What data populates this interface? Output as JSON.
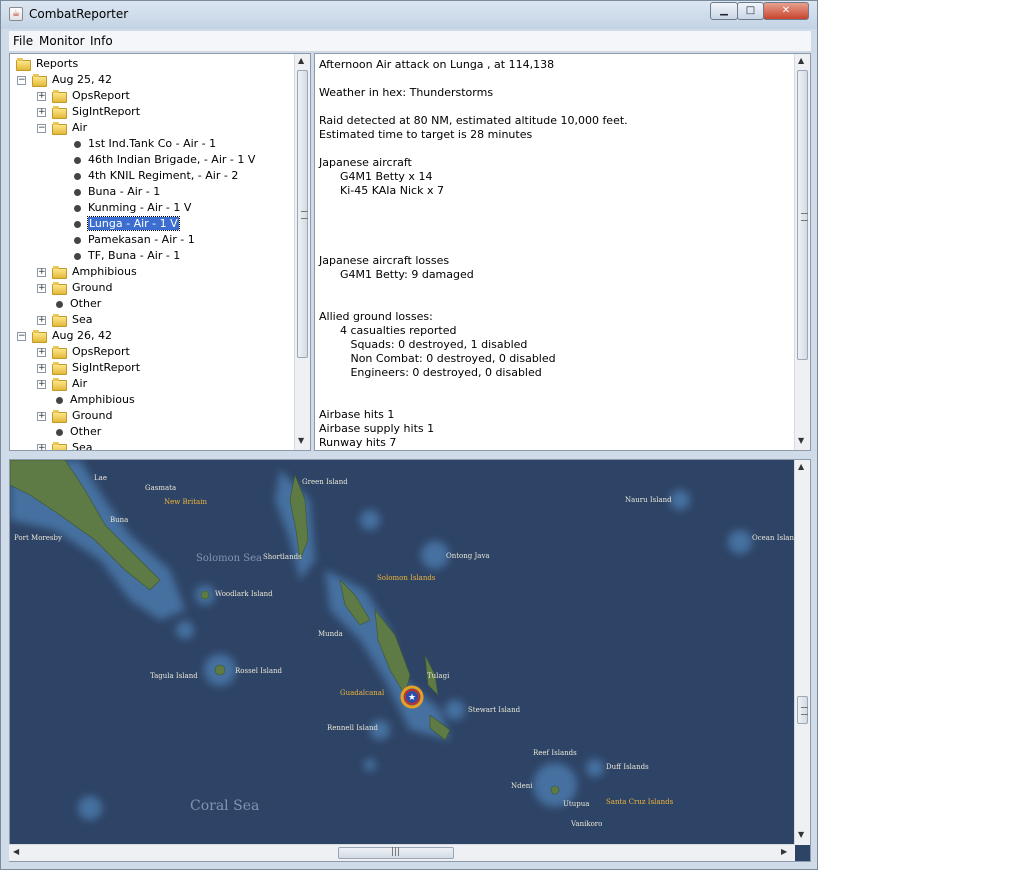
{
  "window": {
    "title": "CombatReporter",
    "app_icon": "java-icon",
    "controls": {
      "minimize": "minimize-icon",
      "maximize": "maximize-icon",
      "close": "close-icon"
    }
  },
  "menu": [
    "File",
    "Monitor",
    "Info"
  ],
  "tree": {
    "root": "Reports",
    "rows": [
      {
        "label": "Aug 25, 42",
        "type": "folder",
        "level": 1,
        "expander": "-"
      },
      {
        "label": "OpsReport",
        "type": "folder",
        "level": 2,
        "expander": "+"
      },
      {
        "label": "SigIntReport",
        "type": "folder",
        "level": 2,
        "expander": "+"
      },
      {
        "label": "Air",
        "type": "folder",
        "level": 2,
        "expander": "-"
      },
      {
        "label": "1st Ind.Tank Co  - Air - 1",
        "type": "leaf",
        "level": 3
      },
      {
        "label": "46th Indian Brigade,  - Air - 1 V",
        "type": "leaf",
        "level": 3
      },
      {
        "label": "4th KNIL Regiment,  - Air - 2",
        "type": "leaf",
        "level": 3
      },
      {
        "label": "Buna  - Air - 1",
        "type": "leaf",
        "level": 3
      },
      {
        "label": "Kunming  - Air - 1 V",
        "type": "leaf",
        "level": 3
      },
      {
        "label": "Lunga  - Air - 1 V",
        "type": "leaf",
        "level": 3,
        "selected": true
      },
      {
        "label": "Pamekasan  - Air - 1",
        "type": "leaf",
        "level": 3
      },
      {
        "label": "TF, Buna  - Air - 1",
        "type": "leaf",
        "level": 3
      },
      {
        "label": "Amphibious",
        "type": "folder",
        "level": 2,
        "expander": "+"
      },
      {
        "label": "Ground",
        "type": "folder",
        "level": 2,
        "expander": "+"
      },
      {
        "label": "Other",
        "type": "leaf",
        "level": 2
      },
      {
        "label": "Sea",
        "type": "folder",
        "level": 2,
        "expander": "+"
      },
      {
        "label": "Aug 26, 42",
        "type": "folder",
        "level": 1,
        "expander": "-"
      },
      {
        "label": "OpsReport",
        "type": "folder",
        "level": 2,
        "expander": "+"
      },
      {
        "label": "SigIntReport",
        "type": "folder",
        "level": 2,
        "expander": "+"
      },
      {
        "label": "Air",
        "type": "folder",
        "level": 2,
        "expander": "+"
      },
      {
        "label": "Amphibious",
        "type": "leaf",
        "level": 2
      },
      {
        "label": "Ground",
        "type": "folder",
        "level": 2,
        "expander": "+"
      },
      {
        "label": "Other",
        "type": "leaf",
        "level": 2
      },
      {
        "label": "Sea",
        "type": "folder",
        "level": 2,
        "expander": "+"
      }
    ]
  },
  "report": {
    "lines": [
      "Afternoon Air attack on Lunga , at 114,138",
      "",
      "Weather in hex: Thunderstorms",
      "",
      "Raid detected at 80 NM, estimated altitude 10,000 feet.",
      "Estimated time to target is 28 minutes",
      "",
      "Japanese aircraft",
      "      G4M1 Betty x 14",
      "      Ki-45 KAIa Nick x 7",
      "",
      "",
      "",
      "",
      "Japanese aircraft losses",
      "      G4M1 Betty: 9 damaged",
      "",
      "",
      "Allied ground losses:",
      "      4 casualties reported",
      "         Squads: 0 destroyed, 1 disabled",
      "         Non Combat: 0 destroyed, 0 disabled",
      "         Engineers: 0 destroyed, 0 disabled",
      "",
      "",
      "Airbase hits 1",
      "Airbase supply hits 1",
      "Runway hits 7"
    ]
  },
  "map": {
    "labels": [
      {
        "text": "Lae",
        "style": "white"
      },
      {
        "text": "Gasmata",
        "style": "white"
      },
      {
        "text": "New Britain",
        "style": "gold"
      },
      {
        "text": "Buna",
        "style": "white"
      },
      {
        "text": "Port Moresby",
        "style": "white"
      },
      {
        "text": "Solomon Sea",
        "style": "sea"
      },
      {
        "text": "Shortlands",
        "style": "white"
      },
      {
        "text": "Green Island",
        "style": "white"
      },
      {
        "text": "Woodlark Island",
        "style": "white"
      },
      {
        "text": "Ontong Java",
        "style": "white"
      },
      {
        "text": "Solomon Islands",
        "style": "gold"
      },
      {
        "text": "Munda",
        "style": "white"
      },
      {
        "text": "Rossel Island",
        "style": "white"
      },
      {
        "text": "Tagula Island",
        "style": "white"
      },
      {
        "text": "Tulagi",
        "style": "white"
      },
      {
        "text": "Guadalcanal",
        "style": "gold"
      },
      {
        "text": "Stewart Island",
        "style": "white"
      },
      {
        "text": "Rennell Island",
        "style": "white"
      },
      {
        "text": "Nauru Island",
        "style": "white"
      },
      {
        "text": "Ocean Island",
        "style": "white"
      },
      {
        "text": "Reef Islands",
        "style": "white"
      },
      {
        "text": "Duff Islands",
        "style": "white"
      },
      {
        "text": "Ndeni",
        "style": "white"
      },
      {
        "text": "Utupua",
        "style": "white"
      },
      {
        "text": "Santa Cruz Islands",
        "style": "gold"
      },
      {
        "text": "Vanikoro",
        "style": "white"
      },
      {
        "text": "Coral Sea",
        "style": "sea-big"
      }
    ],
    "marker": "allied-star-icon"
  }
}
